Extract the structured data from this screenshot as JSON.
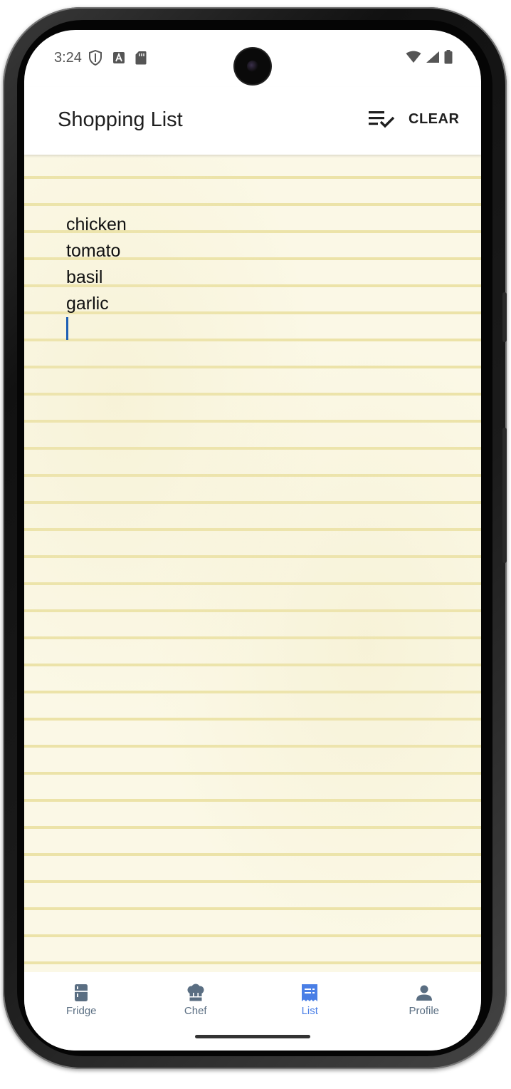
{
  "status_bar": {
    "time": "3:24",
    "left_icons": [
      "shield-icon",
      "font-a-icon",
      "sd-card-icon"
    ],
    "right_icons": [
      "wifi-icon",
      "cell-signal-icon",
      "battery-icon"
    ]
  },
  "app_bar": {
    "title": "Shopping List",
    "checklist_icon": "checklist-icon",
    "clear_label": "CLEAR"
  },
  "list": {
    "items": [
      "chicken",
      "tomato",
      "basil",
      "garlic"
    ]
  },
  "nav": {
    "items": [
      {
        "label": "Fridge",
        "icon": "fridge-icon",
        "active": false
      },
      {
        "label": "Chef",
        "icon": "chef-hat-icon",
        "active": false
      },
      {
        "label": "List",
        "icon": "receipt-list-icon",
        "active": true
      },
      {
        "label": "Profile",
        "icon": "person-icon",
        "active": false
      }
    ]
  },
  "colors": {
    "accent": "#4a7fe6",
    "nav_inactive": "#5a6e82",
    "paper": "#fbf8e6",
    "paper_lines": "#ece3a8",
    "cursor": "#1e5fb4"
  }
}
